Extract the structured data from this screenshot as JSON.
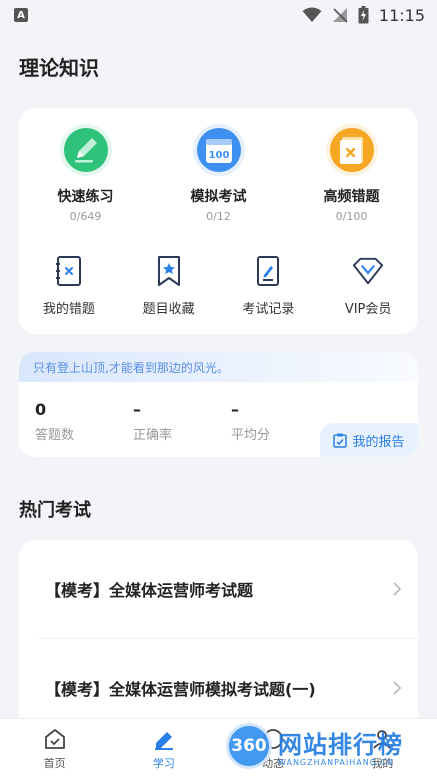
{
  "status_bar": {
    "time": "11:15",
    "app_icon": "A"
  },
  "page_title": "理论知识",
  "features": [
    {
      "label": "快速练习",
      "count": "0/649",
      "icon": "pencil-icon",
      "color": "#2fc27a"
    },
    {
      "label": "模拟考试",
      "count": "0/12",
      "icon": "calendar-100-icon",
      "color": "#3d8ff0",
      "badge": "100"
    },
    {
      "label": "高频错题",
      "count": "0/100",
      "icon": "wrong-book-icon",
      "color": "#f5a623"
    }
  ],
  "tools": [
    {
      "label": "我的错题",
      "icon": "wrong-notebook-icon"
    },
    {
      "label": "题目收藏",
      "icon": "bookmark-star-icon"
    },
    {
      "label": "考试记录",
      "icon": "exam-record-icon"
    },
    {
      "label": "VIP会员",
      "icon": "vip-diamond-icon"
    }
  ],
  "stats": {
    "banner": "只有登上山顶,才能看到那边的风光。",
    "items": [
      {
        "value": "0",
        "label": "答题数"
      },
      {
        "value": "–",
        "label": "正确率"
      },
      {
        "value": "–",
        "label": "平均分"
      }
    ],
    "report_label": "我的报告"
  },
  "hot_exams": {
    "title": "热门考试",
    "items": [
      {
        "title": "【模考】全媒体运营师考试题"
      },
      {
        "title": "【模考】全媒体运营师模拟考试题(一)"
      }
    ]
  },
  "tabs": [
    {
      "label": "首页",
      "icon": "home-icon",
      "active": false
    },
    {
      "label": "学习",
      "icon": "study-icon",
      "active": true
    },
    {
      "label": "动态",
      "icon": "feed-icon",
      "active": false
    },
    {
      "label": "我的",
      "icon": "profile-icon",
      "active": false
    }
  ],
  "watermark": {
    "logo": "360",
    "main": "网站排行榜",
    "sub": "WANGZHANPAIHANG.CN"
  },
  "colors": {
    "accent": "#2a7fe8",
    "background": "#f2f4f8"
  }
}
